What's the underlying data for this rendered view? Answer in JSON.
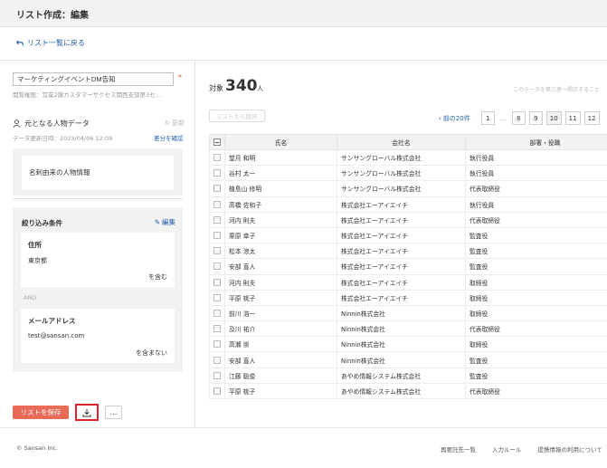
{
  "header": {
    "title": "リスト作成：編集"
  },
  "back_link": "リスト一覧に戻る",
  "list_form": {
    "name_value": "マーケティングイベントDM告知",
    "required_mark": "*",
    "view_permission": "閲覧権限：営業2課カスタマーサクセス関西支部第3セ…"
  },
  "source": {
    "label": "元となる人物データ",
    "refresh_label": "更新",
    "updated_at": "データ更新日時：2023/04/06 12:09",
    "diff_link": "差分を確認",
    "source_name": "名刺由来の人物情報"
  },
  "filter": {
    "title": "絞り込み条件",
    "edit_label": "編集",
    "and_label": "AND",
    "conditions": [
      {
        "field": "住所",
        "value": "東京都",
        "operator": "を含む"
      },
      {
        "field": "メールアドレス",
        "value": "test@sansan.com",
        "operator": "を含まない"
      }
    ]
  },
  "actions": {
    "save_label": "リストを保存",
    "more_label": "..."
  },
  "results": {
    "count_prefix": "対象",
    "count": "340",
    "count_unit": "人",
    "note": "このデータを第三者へ開示すること",
    "remove_button": "リストから除外"
  },
  "pagination": {
    "prev_label": "前の20件",
    "pages": [
      "1",
      "…",
      "8",
      "9",
      "10",
      "11",
      "12"
    ],
    "current": "10"
  },
  "table": {
    "columns": [
      "氏名",
      "会社名",
      "部署・役職"
    ],
    "rows": [
      [
        "望月 和明",
        "サンサングローバル株式会社",
        "執行役員"
      ],
      [
        "谷村 太一",
        "サンサングローバル株式会社",
        "執行役員"
      ],
      [
        "植島山 修明",
        "サンサングローバル株式会社",
        "代表取締役"
      ],
      [
        "高橋 佐和子",
        "株式会社エーアイエイチ",
        "執行役員"
      ],
      [
        "河内 則夫",
        "株式会社エーアイエイチ",
        "代表取締役"
      ],
      [
        "栗原 幸子",
        "株式会社エーアイエイチ",
        "監査役"
      ],
      [
        "松本 涼太",
        "株式会社エーアイエイチ",
        "監査役"
      ],
      [
        "安部 直人",
        "株式会社エーアイエイチ",
        "監査役"
      ],
      [
        "河内 則夫",
        "株式会社エーアイエイチ",
        "取締役"
      ],
      [
        "平原 桃子",
        "株式会社エーアイエイチ",
        "取締役"
      ],
      [
        "前川 浩一",
        "Ninnin株式会社",
        "取締役"
      ],
      [
        "及川 祐介",
        "Ninnin株式会社",
        "代表取締役"
      ],
      [
        "高瀬 崇",
        "Ninnin株式会社",
        "取締役"
      ],
      [
        "安部 直人",
        "Ninnin株式会社",
        "監査役"
      ],
      [
        "江藤 聡俊",
        "あやめ情報システム株式会社",
        "監査役"
      ],
      [
        "平原 桃子",
        "あやめ情報システム株式会社",
        "代表取締役"
      ]
    ]
  },
  "footer": {
    "copyright": "© Sansan Inc.",
    "links": [
      "再要託先一覧",
      "入力ルール",
      "提携情報の利用について"
    ]
  },
  "colors": {
    "accent": "#1f5fa8",
    "save_button": "#ea6a58",
    "highlight_border": "#d8262c"
  }
}
